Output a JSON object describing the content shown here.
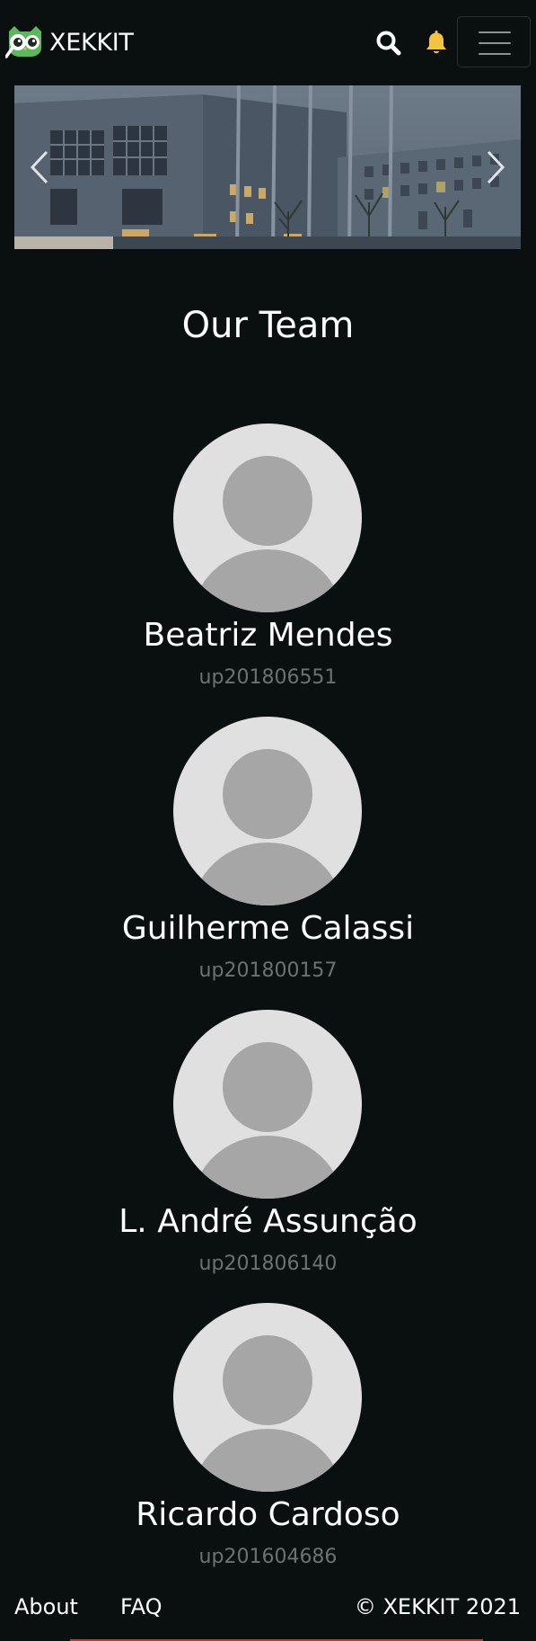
{
  "navbar": {
    "brand_text": "XEKKIT",
    "icons": {
      "logo": "owl-logo-icon",
      "search": "search-icon",
      "notifications": "bell-icon",
      "menu": "hamburger-icon"
    },
    "bell_color": "#f5c242"
  },
  "carousel": {
    "icons": {
      "prev": "chevron-left-icon",
      "next": "chevron-right-icon"
    }
  },
  "team": {
    "title": "Our Team",
    "members": [
      {
        "name": "Beatriz Mendes",
        "id": "up201806551"
      },
      {
        "name": "Guilherme Calassi",
        "id": "up201800157"
      },
      {
        "name": "L. André Assunção",
        "id": "up201806140"
      },
      {
        "name": "Ricardo Cardoso",
        "id": "up201604686"
      }
    ]
  },
  "footer": {
    "about": "About",
    "faq": "FAQ",
    "copyright": "© XEKKIT 2021"
  },
  "colors": {
    "background": "#0a100f",
    "text": "#ffffff",
    "muted": "#6c7172",
    "accent": "#c0392b",
    "logo_green": "#5cb85c"
  }
}
